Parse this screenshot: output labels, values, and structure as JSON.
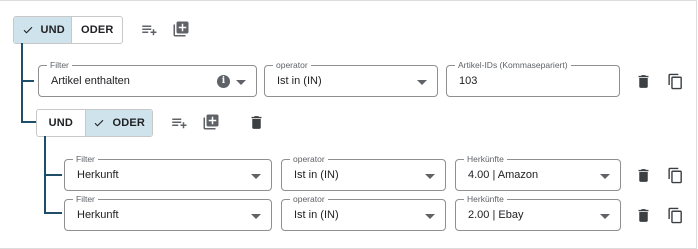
{
  "colors": {
    "accent_active": "#cfe3ec",
    "connector": "#1f4e6b",
    "icon": "#5f6368"
  },
  "icons": {
    "add_rule": "playlist-add-icon",
    "add_group": "library-add-icon",
    "delete": "trash-icon",
    "copy": "copy-icon",
    "check": "check-icon",
    "info": "info-icon",
    "dropdown": "caret-down-icon"
  },
  "root_group": {
    "toggle": {
      "und": "UND",
      "oder": "ODER",
      "active": "UND"
    },
    "rule": {
      "filter": {
        "label": "Filter",
        "value": "Artikel enthalten",
        "info": "i"
      },
      "operator": {
        "label": "operator",
        "value": "Ist in (IN)"
      },
      "value": {
        "label": "Artikel-IDs (Kommasepariert)",
        "value": "103"
      }
    },
    "subgroup": {
      "toggle": {
        "und": "UND",
        "oder": "ODER",
        "active": "ODER"
      },
      "rules": [
        {
          "filter": {
            "label": "Filter",
            "value": "Herkunft"
          },
          "operator": {
            "label": "operator",
            "value": "Ist in (IN)"
          },
          "value": {
            "label": "Herkünfte",
            "value": "4.00 | Amazon"
          }
        },
        {
          "filter": {
            "label": "Filter",
            "value": "Herkunft"
          },
          "operator": {
            "label": "operator",
            "value": "Ist in (IN)"
          },
          "value": {
            "label": "Herkünfte",
            "value": "2.00 | Ebay"
          }
        }
      ]
    }
  }
}
